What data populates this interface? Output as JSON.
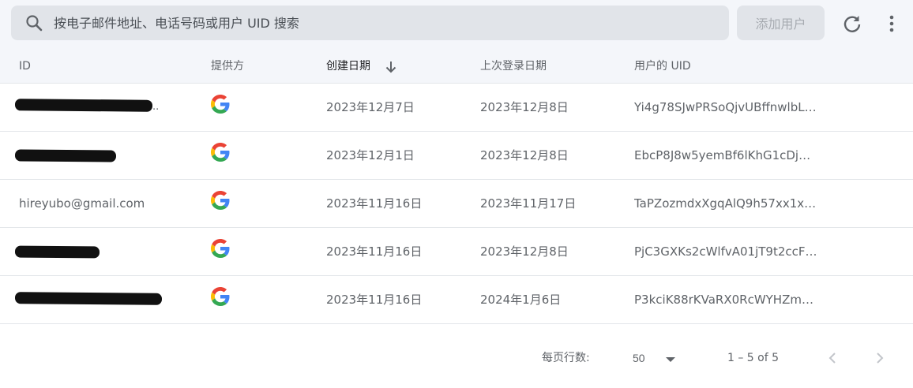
{
  "search": {
    "placeholder": "按电子邮件地址、电话号码或用户 UID 搜索"
  },
  "toolbar": {
    "add_user_label": "添加用户",
    "refresh_icon": "refresh-icon",
    "more_icon": "more-vert-icon"
  },
  "table": {
    "headers": {
      "id": "ID",
      "provider": "提供方",
      "created": "创建日期",
      "last_login": "上次登录日期",
      "uid": "用户的 UID"
    },
    "sort": {
      "column": "created",
      "direction": "descending",
      "icon": "arrow-down-icon"
    },
    "rows": [
      {
        "id": "",
        "id_redacted": true,
        "provider": "google-icon",
        "created": "2023年12月7日",
        "last_login": "2023年12月8日",
        "uid": "Yi4g78SJwPRSoQjvUBffnwlbL…"
      },
      {
        "id": "",
        "id_redacted": true,
        "provider": "google-icon",
        "created": "2023年12月1日",
        "last_login": "2023年12月8日",
        "uid": "EbcP8J8w5yemBf6lKhG1cDj…"
      },
      {
        "id": "hireyubo@gmail.com",
        "id_redacted": false,
        "provider": "google-icon",
        "created": "2023年11月16日",
        "last_login": "2023年11月17日",
        "uid": "TaPZozmdxXgqAlQ9h57xx1xQ…"
      },
      {
        "id": "",
        "id_redacted": true,
        "provider": "google-icon",
        "created": "2023年11月16日",
        "last_login": "2023年12月8日",
        "uid": "PjC3GXKs2cWlfvA01jT9t2ccF…"
      },
      {
        "id": "",
        "id_redacted": true,
        "provider": "google-icon",
        "created": "2023年11月16日",
        "last_login": "2024年1月6日",
        "uid": "P3kciK88rKVaRX0RcWYHZmP…"
      }
    ]
  },
  "footer": {
    "rows_per_page_label": "每页行数:",
    "rows_per_page_value": "50",
    "range_label": "1 – 5 of 5"
  },
  "colors": {
    "header_bg": "#f4f6fa",
    "search_bg": "#e1e4e9",
    "google_blue": "#4285F4",
    "google_red": "#EA4335",
    "google_yellow": "#FBBC05",
    "google_green": "#34A853"
  }
}
